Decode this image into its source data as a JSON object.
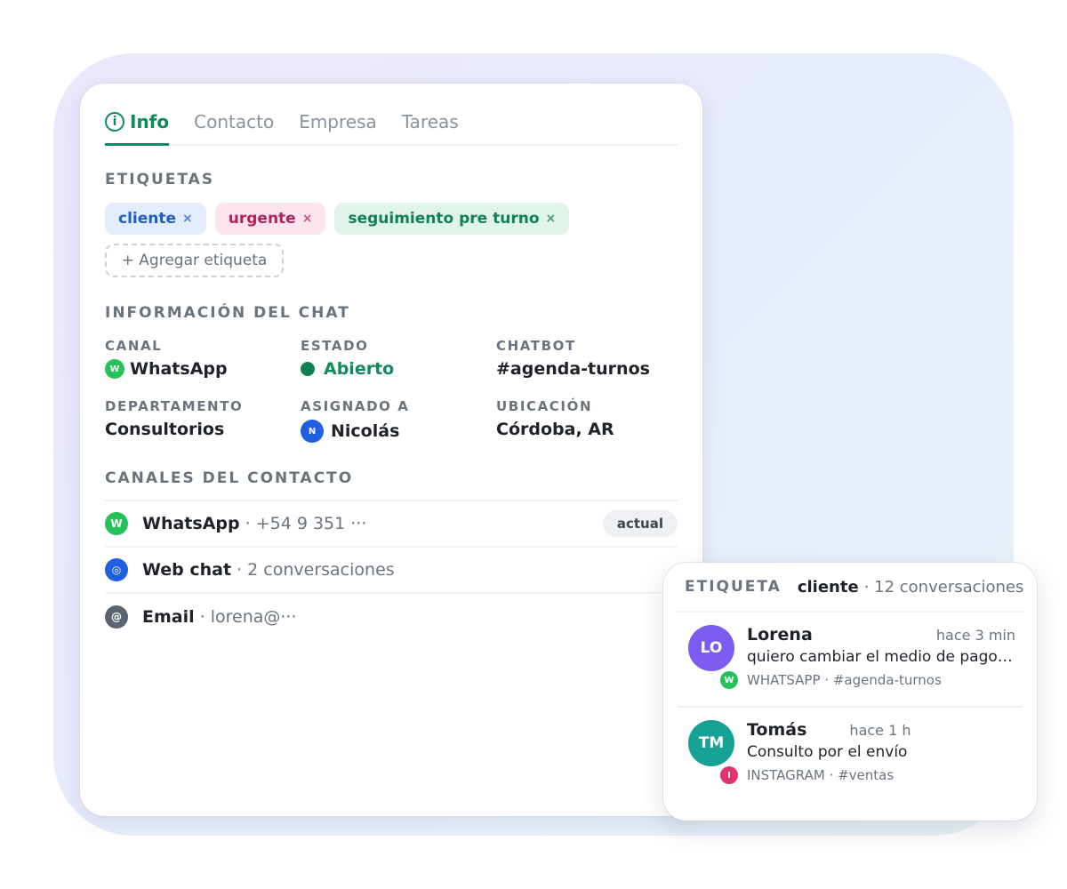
{
  "tabs": [
    {
      "label": "Info",
      "active": true
    },
    {
      "label": "Contacto"
    },
    {
      "label": "Empresa"
    },
    {
      "label": "Tareas"
    }
  ],
  "labels_section": {
    "title": "ETIQUETAS",
    "chips": [
      {
        "label": "cliente",
        "color": "#1f5fc4"
      },
      {
        "label": "urgente",
        "color": "#b0245e"
      },
      {
        "label": "seguimiento pre turno",
        "color": "#118054"
      }
    ],
    "remove_glyph": "×",
    "add_label": "+ Agregar etiqueta"
  },
  "chat_info": {
    "title": "INFORMACIÓN DEL CHAT",
    "fields": {
      "canal": {
        "label": "CANAL",
        "value": "WhatsApp",
        "badge": "W"
      },
      "estado": {
        "label": "ESTADO",
        "value": "Abierto",
        "color": "#0f8a5b"
      },
      "chatbot": {
        "label": "CHATBOT",
        "value": "#agenda-turnos"
      },
      "departamento": {
        "label": "DEPARTAMENTO",
        "value": "Consultorios"
      },
      "asignado": {
        "label": "ASIGNADO A",
        "value": "Nicolás",
        "badge": "N"
      },
      "ubicacion": {
        "label": "UBICACIÓN",
        "value": "Córdoba, AR"
      }
    }
  },
  "contact_channels": {
    "title": "CANALES DEL CONTACTO",
    "items": [
      {
        "badge": "W",
        "name": "WhatsApp",
        "detail": "· +54 9 351 ···",
        "pill": "actual"
      },
      {
        "badge": "◎",
        "name": "Web chat",
        "detail": "· 2 conversaciones"
      },
      {
        "badge": "@",
        "name": "Email",
        "detail": "· lorena@···"
      }
    ]
  },
  "tag_popup": {
    "label": "ETIQUETA",
    "tag": "cliente",
    "count": "· 12 conversaciones",
    "conversations": [
      {
        "initials": "LO",
        "name": "Lorena",
        "time": "hace 3 min",
        "message": "quiero cambiar el medio de pago para el turno",
        "channel_badge": "W",
        "meta": "WHATSAPP · #agenda-turnos",
        "avatar_color": "#7c5cf0"
      },
      {
        "initials": "TM",
        "name": "Tomás",
        "time": "hace 1 h",
        "message": "Consulto por el envío",
        "channel_badge": "I",
        "meta": "INSTAGRAM · #ventas",
        "avatar_color": "#17a394"
      }
    ]
  },
  "colors": {
    "accent": "#0f8a5b",
    "whatsapp": "#25c25a",
    "webchat": "#1f5fe0",
    "email": "#5b6470",
    "instagram": "#e0336b"
  },
  "icons": {
    "info_tab": "info-circle-icon",
    "remove_chip": "close-icon",
    "whatsapp": "whatsapp-icon",
    "webchat": "webchat-icon",
    "email": "email-icon",
    "instagram": "instagram-icon",
    "status": "status-dot-icon"
  }
}
